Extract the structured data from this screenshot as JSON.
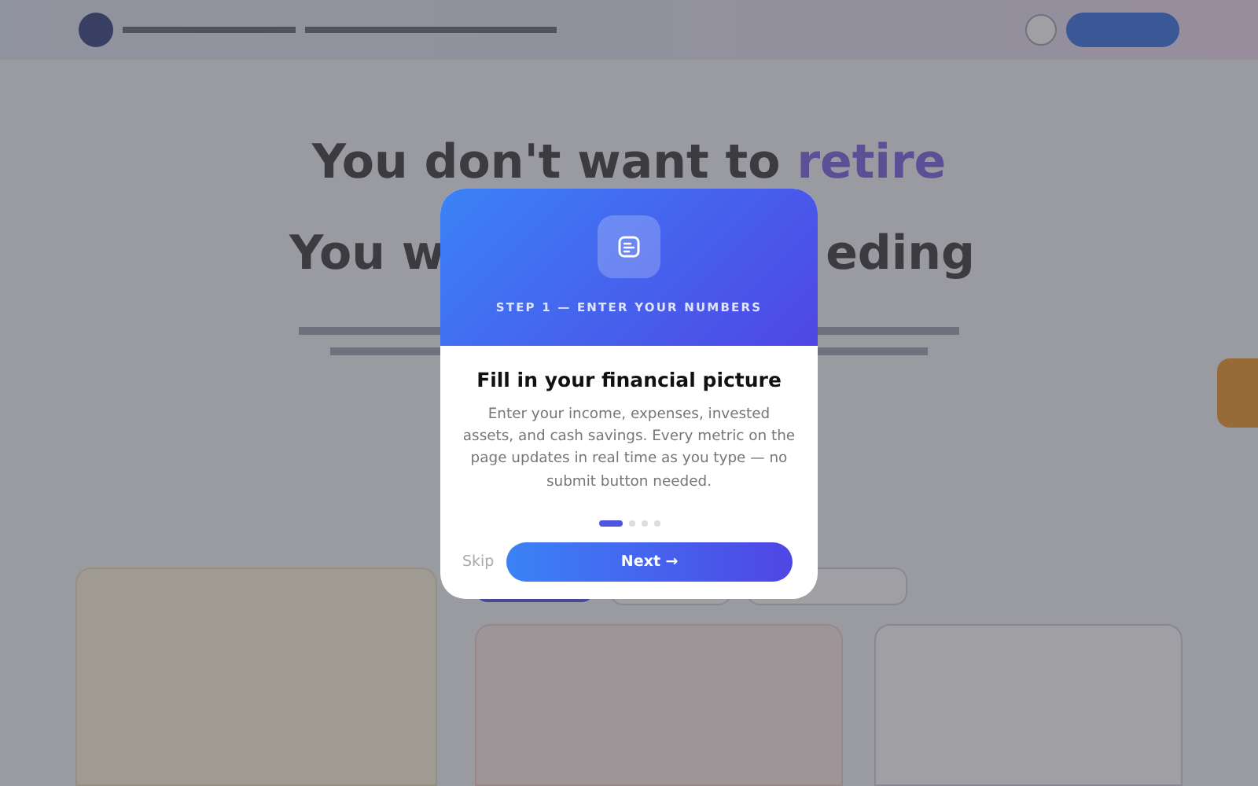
{
  "background": {
    "headline": {
      "start": "You don't want to ",
      "highlight": "retire"
    },
    "second_line_left": "You w",
    "second_line_right": "eding"
  },
  "modal": {
    "step_label": "STEP 1 — ENTER YOUR NUMBERS",
    "title": "Fill in your financial picture",
    "body": "Enter your income, expenses, invested assets, and cash savings. Every metric on the page updates in real time as you type — no submit button needed.",
    "steps": [
      {
        "selected": true
      },
      {
        "selected": false
      },
      {
        "selected": false
      },
      {
        "selected": false
      }
    ],
    "skip": "Skip",
    "next": "Next →"
  }
}
